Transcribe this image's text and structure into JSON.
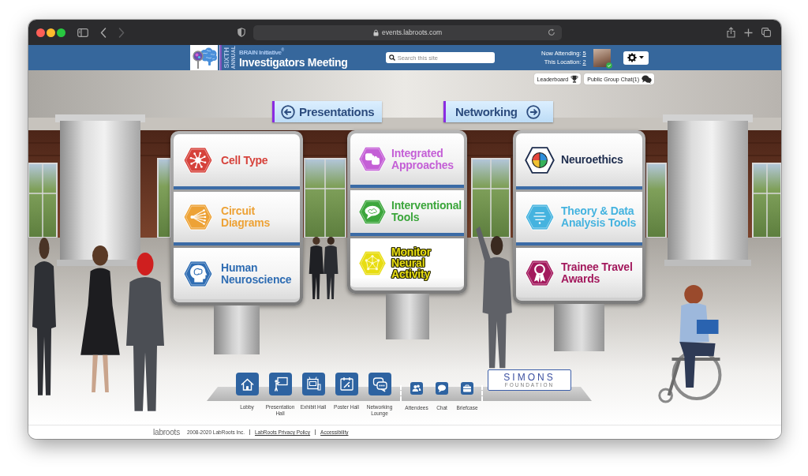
{
  "browser": {
    "url": "events.labroots.com",
    "nav_buttons": [
      {
        "kind": "back",
        "disabled": false
      },
      {
        "kind": "forward",
        "disabled": true
      }
    ]
  },
  "header": {
    "edition": "SIXTH",
    "edition_note": "ANNUAL",
    "subtitle": "BRAIN Initiative$^{®}$",
    "title": "Investigators Meeting",
    "search": {
      "placeholder": "Search this site"
    },
    "stats": [
      {
        "label": "Now Attending:",
        "value": "5"
      },
      {
        "label": "This Location:",
        "value": "2"
      }
    ]
  },
  "quick_buttons": [
    {
      "label": "Leaderboard"
    },
    {
      "label": "Public Group Chat(1)"
    }
  ],
  "directions": [
    {
      "kind": "back",
      "label": "Presentations"
    },
    {
      "kind": "forward",
      "label": "Networking"
    }
  ],
  "signboards": [
    {
      "panels": [
        {
          "label": "Cell Type",
          "color": "#d6423b"
        },
        {
          "label": "Circuit Diagrams",
          "color": "#eda236"
        },
        {
          "label": "Human Neuroscience",
          "color": "#2f6db3"
        }
      ]
    },
    {
      "panels": [
        {
          "label": "Integrated Approaches",
          "color": "#c45fd6"
        },
        {
          "label": "Interventional Tools",
          "color": "#3ca63c"
        },
        {
          "label": "Monitor Neural Activity",
          "color": "#e8dd12"
        }
      ]
    },
    {
      "panels": [
        {
          "label": "Neuroethics",
          "color": "#1e2d4e"
        },
        {
          "label": "Theory & Data Analysis Tools",
          "color": "#45b3df"
        },
        {
          "label": "Trainee Travel Awards",
          "color": "#a3195d"
        }
      ]
    }
  ],
  "nav": [
    {
      "kind": "hall",
      "label": "Lobby"
    },
    {
      "kind": "hall",
      "label": "Presentation Hall"
    },
    {
      "kind": "hall",
      "label": "Exhibit Hall"
    },
    {
      "kind": "hall",
      "label": "Poster Hall"
    },
    {
      "kind": "hall",
      "label": "Networking Lounge"
    },
    {
      "kind": "tool",
      "label": "Attendees"
    },
    {
      "kind": "tool",
      "label": "Chat"
    },
    {
      "kind": "tool",
      "label": "Briefcase"
    }
  ],
  "sponsor": {
    "name": "SIMONS",
    "subtitle": "FOUNDATION"
  },
  "footer": {
    "logo": "labroots",
    "copyright": "2008-2020 LabRoots Inc.",
    "links": [
      "LabRoots Privacy Policy",
      "Accessibility"
    ]
  }
}
